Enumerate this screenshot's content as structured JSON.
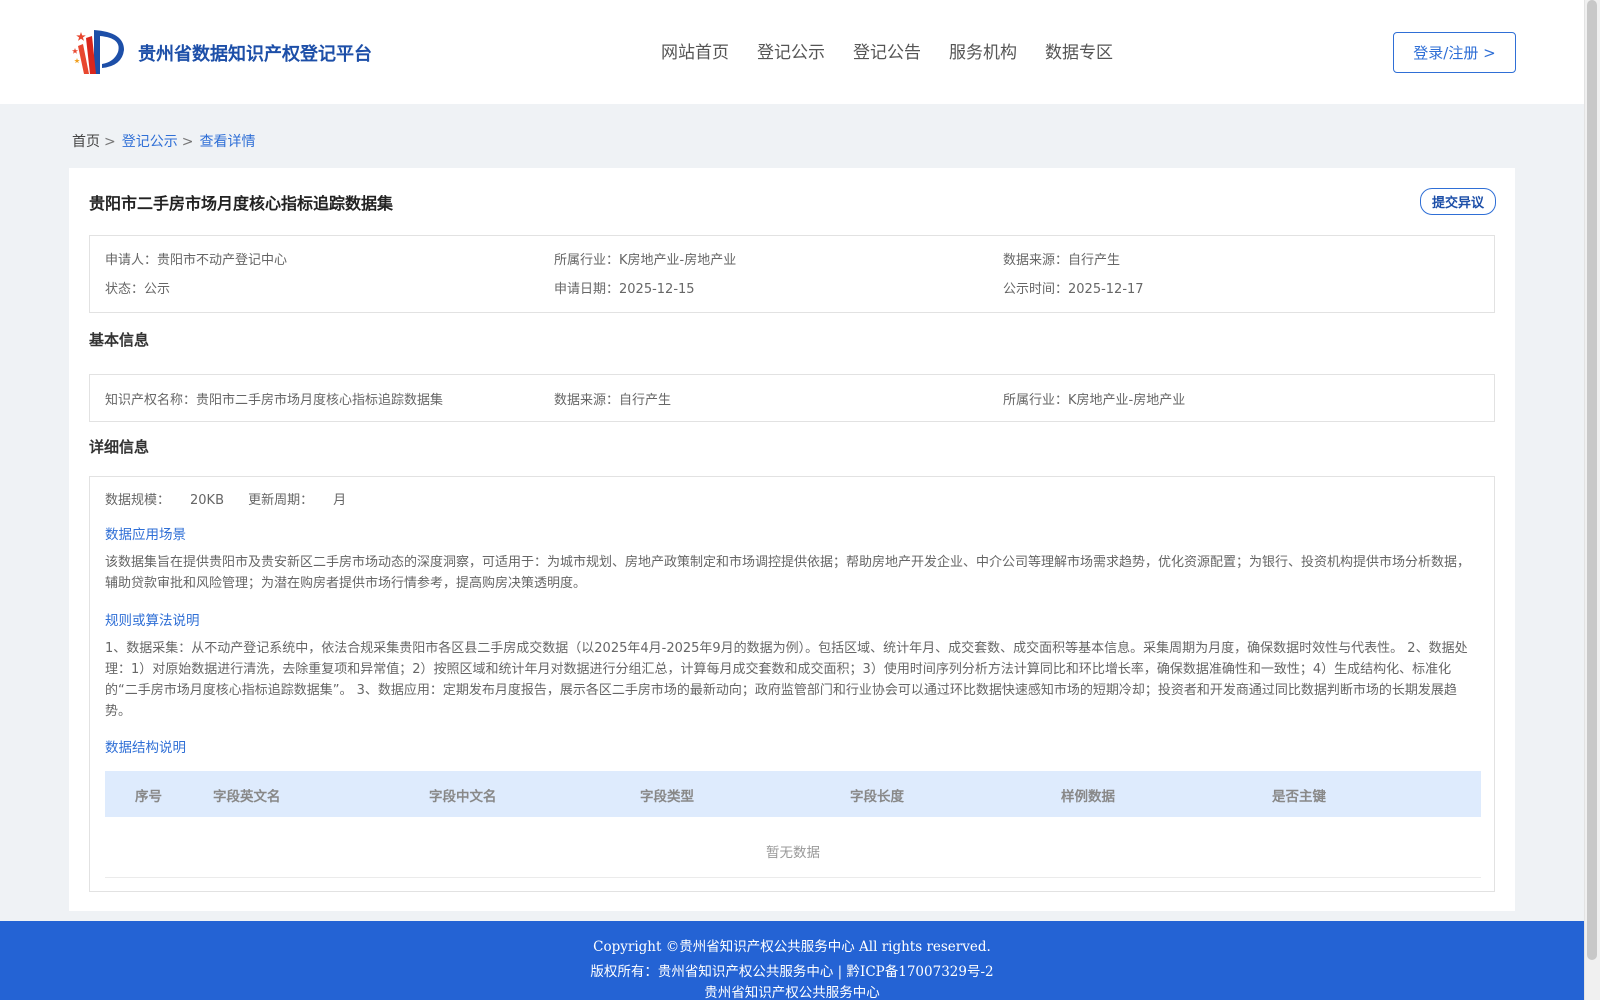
{
  "header": {
    "site_title": "贵州省数据知识产权登记平台",
    "nav": [
      "网站首页",
      "登记公示",
      "登记公告",
      "服务机构",
      "数据专区"
    ],
    "login_label": "登录/注册 >"
  },
  "breadcrumb": {
    "home": "首页",
    "sep1": ">",
    "publicity": "登记公示",
    "sep2": ">",
    "current": "查看详情"
  },
  "detail": {
    "title": "贵阳市二手房市场月度核心指标追踪数据集",
    "objection_label": "提交异议",
    "meta": {
      "applicant_label": "申请人：",
      "applicant": "贵阳市不动产登记中心",
      "industry_label": "所属行业：",
      "industry": "K房地产业-房地产业",
      "source_label": "数据来源：",
      "source": "自行产生",
      "status_label": "状态：",
      "status": "公示",
      "apply_date_label": "申请日期：",
      "apply_date": "2025-12-15",
      "publicity_date_label": "公示时间：",
      "publicity_date": "2025-12-17"
    }
  },
  "basic_info": {
    "heading": "基本信息",
    "ip_name_label": "知识产权名称：",
    "ip_name": "贵阳市二手房市场月度核心指标追踪数据集",
    "source_label": "数据来源：",
    "source": "自行产生",
    "industry_label": "所属行业：",
    "industry": "K房地产业-房地产业"
  },
  "detail_info": {
    "heading": "详细信息",
    "scale_label": "数据规模：",
    "scale": "20KB",
    "cycle_label": "更新周期：",
    "cycle": "月",
    "scene_heading": "数据应用场景",
    "scene_text": "该数据集旨在提供贵阳市及贵安新区二手房市场动态的深度洞察，可适用于：为城市规划、房地产政策制定和市场调控提供依据；帮助房地产开发企业、中介公司等理解市场需求趋势，优化资源配置；为银行、投资机构提供市场分析数据，辅助贷款审批和风险管理；为潜在购房者提供市场行情参考，提高购房决策透明度。",
    "rule_heading": "规则或算法说明",
    "rule_text": "1、数据采集：从不动产登记系统中，依法合规采集贵阳市各区县二手房成交数据（以2025年4月-2025年9月的数据为例）。包括区域、统计年月、成交套数、成交面积等基本信息。采集周期为月度，确保数据时效性与代表性。 2、数据处理：1）对原始数据进行清洗，去除重复项和异常值；2）按照区域和统计年月对数据进行分组汇总，计算每月成交套数和成交面积；3）使用时间序列分析方法计算同比和环比增长率，确保数据准确性和一致性；4）生成结构化、标准化的“二手房市场月度核心指标追踪数据集”。 3、数据应用：定期发布月度报告，展示各区二手房市场的最新动向；政府监管部门和行业协会可以通过环比数据快速感知市场的短期冷却；投资者和开发商通过同比数据判断市场的长期发展趋势。",
    "structure_heading": "数据结构说明",
    "table_headers": [
      "序号",
      "字段英文名",
      "字段中文名",
      "字段类型",
      "字段长度",
      "样例数据",
      "是否主键"
    ],
    "empty_text": "暂无数据"
  },
  "footer": {
    "copyright": "Copyright ©贵州省知识产权公共服务中心 All rights reserved.",
    "rights": "版权所有：贵州省知识产权公共服务中心 | 黔ICP备17007329号-2",
    "org": "贵州省知识产权公共服务中心"
  },
  "colors": {
    "accent": "#2f6fd6",
    "footer_bg": "#2463d4",
    "table_head_bg": "#deebfd",
    "page_bg": "#eff2f5"
  }
}
